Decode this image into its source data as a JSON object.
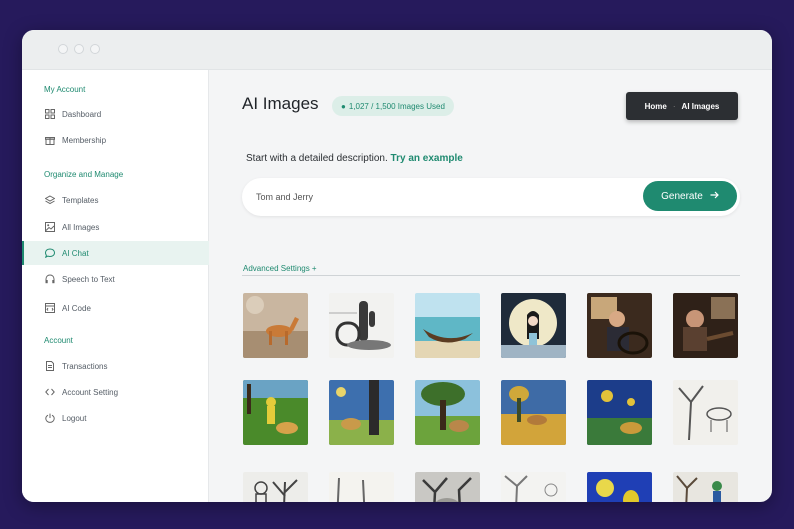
{
  "window": {
    "dots": 3
  },
  "sidebar": {
    "sections": [
      {
        "title": "My Account",
        "items": [
          {
            "label": "Dashboard",
            "icon": "grid-icon"
          },
          {
            "label": "Membership",
            "icon": "gift-icon"
          }
        ]
      },
      {
        "title": "Organize and Manage",
        "items": [
          {
            "label": "Templates",
            "icon": "layers-icon"
          },
          {
            "label": "All Images",
            "icon": "image-icon"
          },
          {
            "label": "AI Chat",
            "icon": "chat-icon",
            "active": true
          },
          {
            "label": "Speech to Text",
            "icon": "headphones-icon"
          },
          {
            "label": "AI Code",
            "icon": "code-window-icon"
          }
        ]
      },
      {
        "title": "Account",
        "items": [
          {
            "label": "Transactions",
            "icon": "document-icon"
          },
          {
            "label": "Account Setting",
            "icon": "code-brackets-icon"
          },
          {
            "label": "Logout",
            "icon": "power-icon"
          }
        ]
      }
    ]
  },
  "header": {
    "title": "AI Images",
    "usage": "1,027 / 1,500 Images Used",
    "breadcrumb": {
      "home": "Home",
      "current": "AI Images"
    }
  },
  "prompt": {
    "intro": "Start with a detailed description.",
    "example_link": "Try an example",
    "input_value": "Tom and Jerry",
    "generate_label": "Generate",
    "advanced_label": "Advanced Settings +"
  },
  "colors": {
    "accent": "#1f8a70",
    "background": "#261a5c",
    "dark": "#2c2f33"
  },
  "gallery": [
    "clay-horse",
    "cactus-sketch",
    "canoe-beach",
    "moon-girl",
    "man-in-car",
    "man-in-car-2",
    "man-dog-field",
    "dog-tree-painting",
    "dog-tree-park",
    "dog-wheat-field",
    "starry-dog",
    "tree-sketch",
    "sketch-figures",
    "sketch-dogs",
    "sketch-trees",
    "sketch-tree-field",
    "blue-yellow-cartoon",
    "figure-trees"
  ]
}
